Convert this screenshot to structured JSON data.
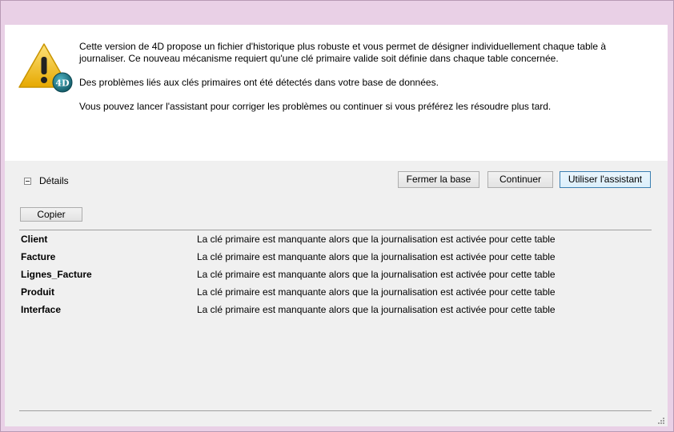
{
  "dialog": {
    "paragraphs": [
      "Cette version de 4D propose un fichier d'historique plus robuste et vous permet de désigner individuellement chaque table à journaliser. Ce nouveau mécanisme requiert qu'une clé primaire valide soit définie dans chaque table concernée.",
      "Des problèmes liés aux clés primaires ont été détectés dans votre base de données.",
      "Vous pouvez lancer l'assistant pour corriger les problèmes ou continuer si vous préférez les résoudre plus tard."
    ],
    "icon": "warning-4d-icon",
    "icon_badge": "4D"
  },
  "details": {
    "label": "Détails",
    "expanded": true,
    "copy_label": "Copier",
    "rows": [
      {
        "name": "Client",
        "message": "La clé primaire est manquante alors que la journalisation est activée pour cette table"
      },
      {
        "name": "Facture",
        "message": "La clé primaire est manquante alors que la journalisation est activée pour cette table"
      },
      {
        "name": "Lignes_Facture",
        "message": "La clé primaire est manquante alors que la journalisation est activée pour cette table"
      },
      {
        "name": "Produit",
        "message": "La clé primaire est manquante alors que la journalisation est activée pour cette table"
      },
      {
        "name": "Interface",
        "message": "La clé primaire est manquante alors que la journalisation est activée pour cette table"
      }
    ]
  },
  "actions": {
    "close_base": "Fermer la base",
    "continue": "Continuer",
    "use_assistant": "Utiliser l'assistant"
  },
  "colors": {
    "window_frame": "#e9d0e6",
    "warning_yellow": "#f5c518",
    "badge_teal": "#1d6f7d",
    "default_button_border": "#3c7fb1"
  }
}
